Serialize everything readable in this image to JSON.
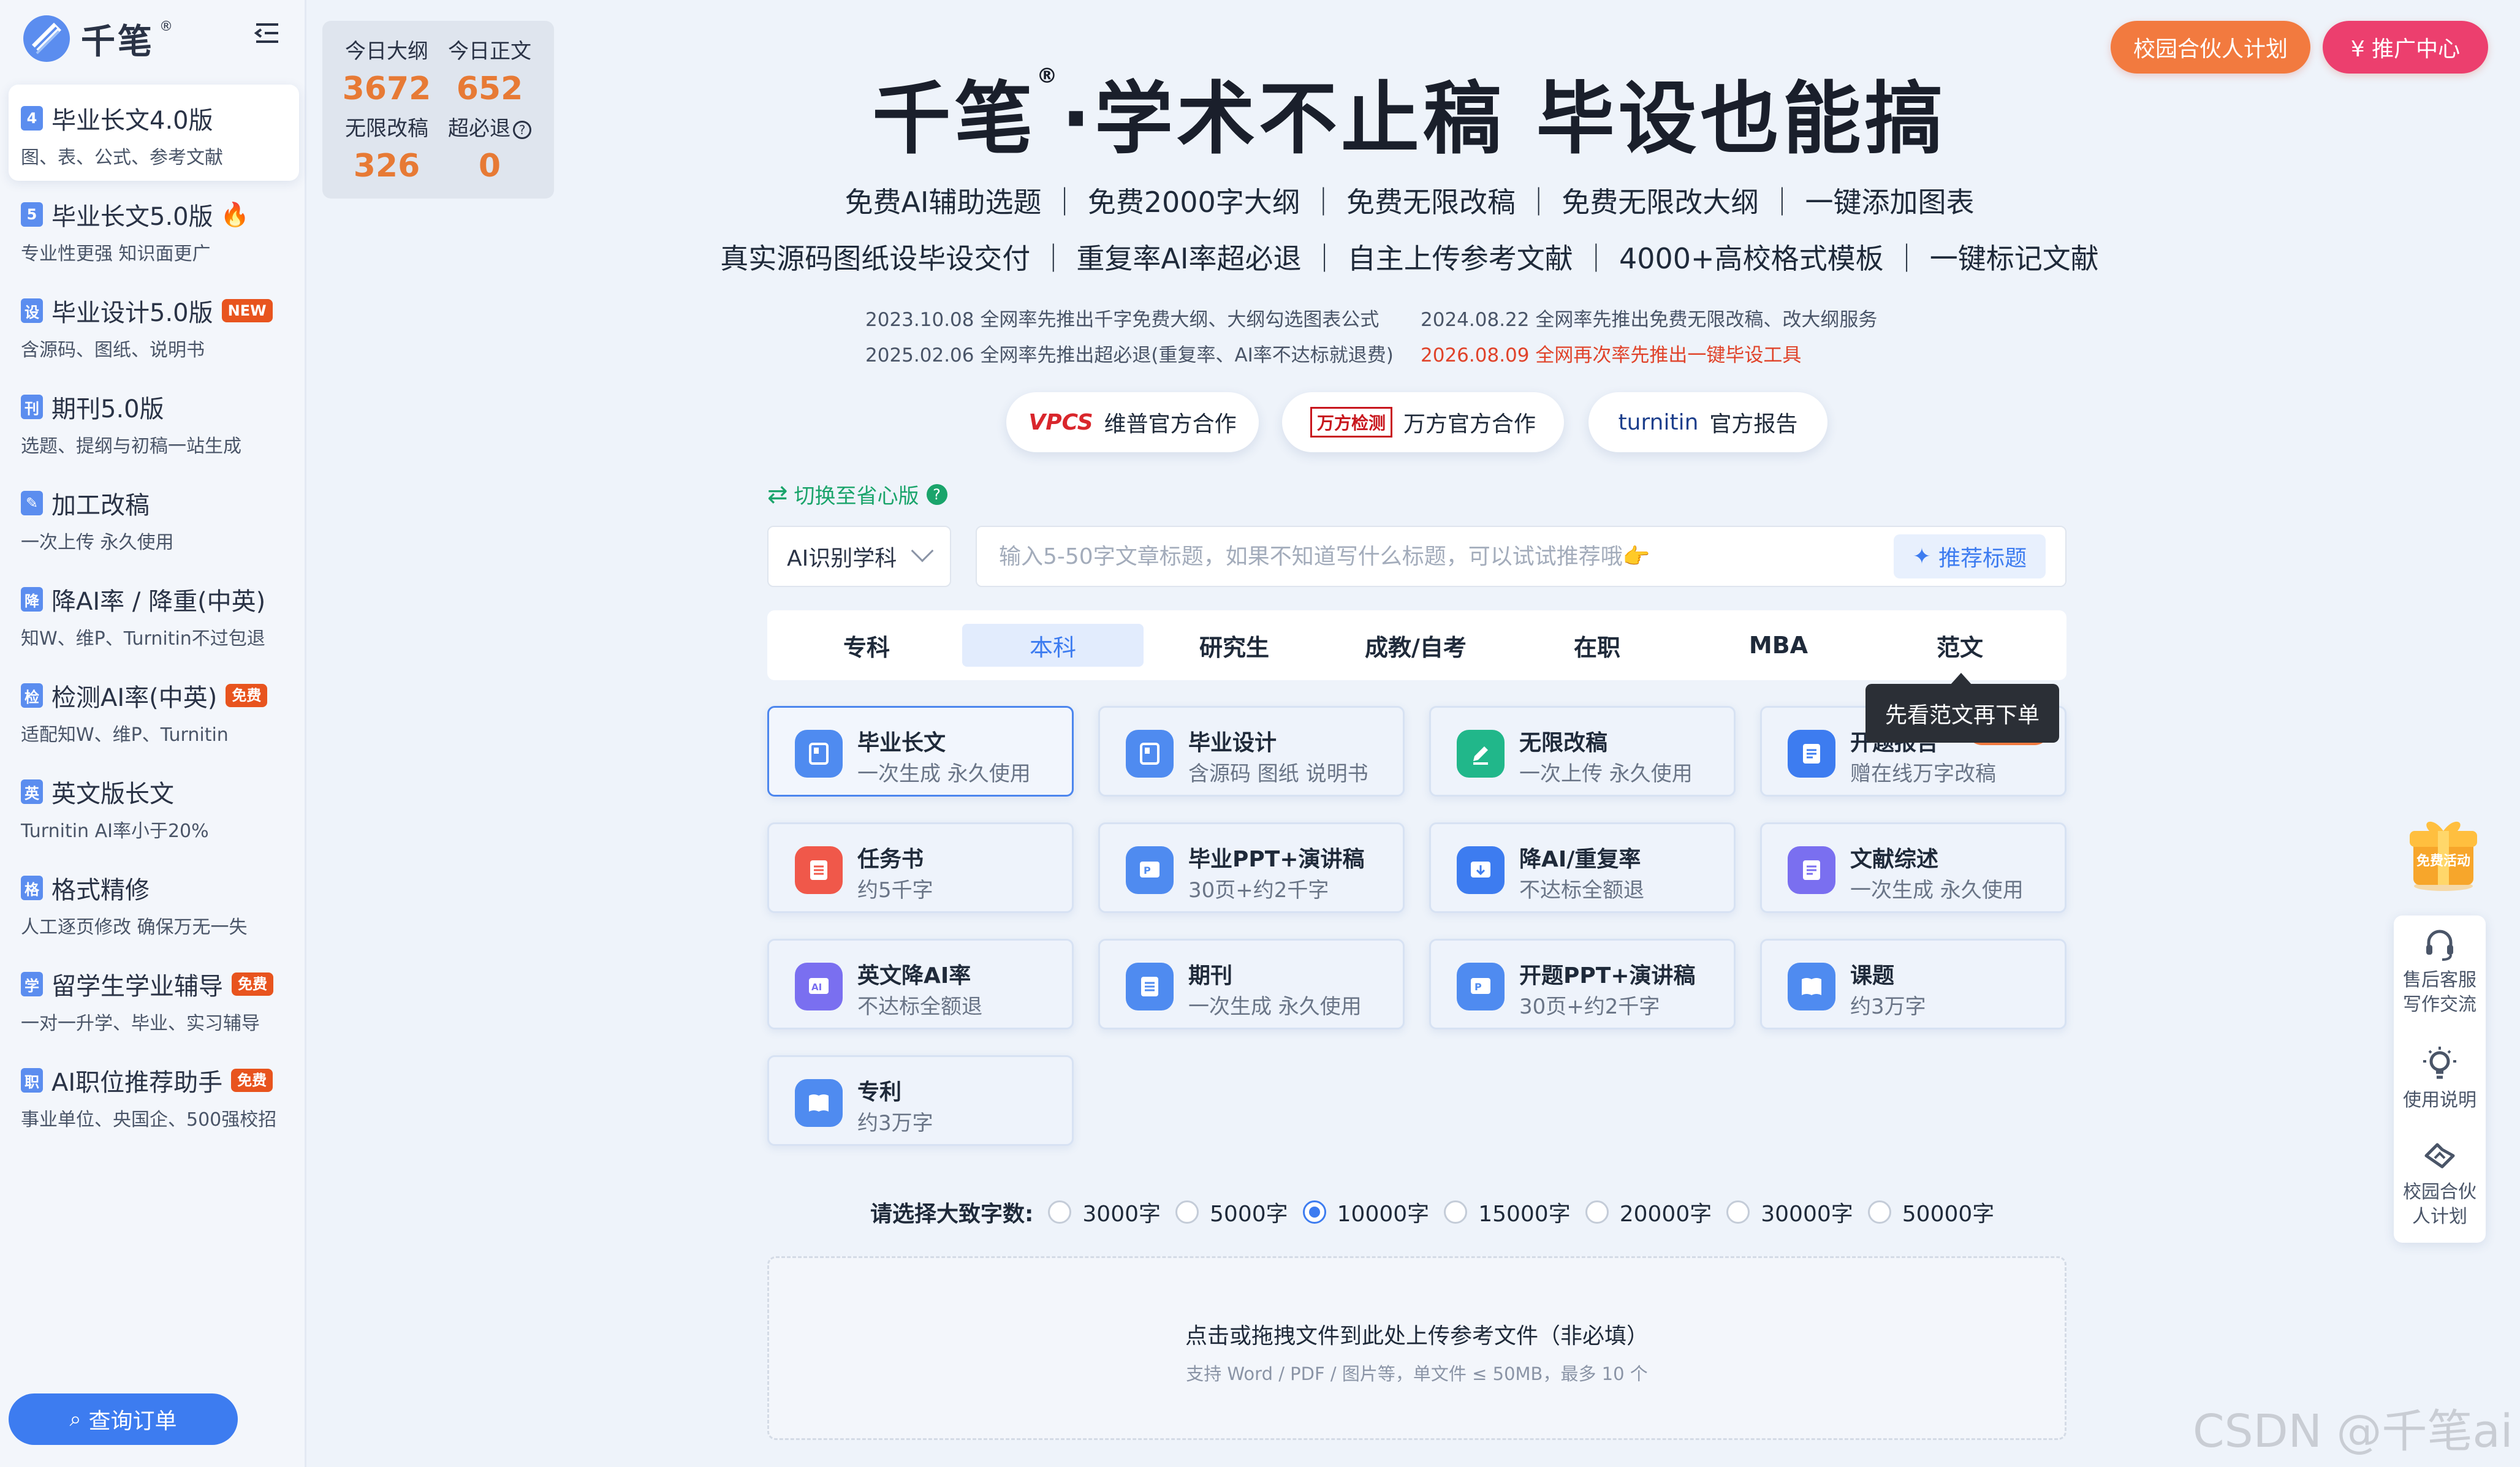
{
  "sidebar": {
    "logo_text": "千笔",
    "logo_reg": "®",
    "items": [
      {
        "icon": "4",
        "title": "毕业长文4.0版",
        "sub": "图、表、公式、参考文献",
        "badge": ""
      },
      {
        "icon": "5",
        "title": "毕业长文5.0版",
        "sub": "专业性更强 知识面更广",
        "badge": ""
      },
      {
        "icon": "设",
        "title": "毕业设计5.0版",
        "sub": "含源码、图纸、说明书",
        "badge": "NEW"
      },
      {
        "icon": "刊",
        "title": "期刊5.0版",
        "sub": "选题、提纲与初稿一站生成",
        "badge": ""
      },
      {
        "icon": "✎",
        "title": "加工改稿",
        "sub": "一次上传 永久使用",
        "badge": ""
      },
      {
        "icon": "降",
        "title": "降AI率 / 降重(中英)",
        "sub": "知W、维P、Turnitin不过包退",
        "badge": ""
      },
      {
        "icon": "检",
        "title": "检测AI率(中英)",
        "sub": "适配知W、维P、Turnitin",
        "badge": "免费"
      },
      {
        "icon": "英",
        "title": "英文版长文",
        "sub": "Turnitin AI率小于20%",
        "badge": ""
      },
      {
        "icon": "格",
        "title": "格式精修",
        "sub": "人工逐页修改 确保万无一失",
        "badge": ""
      },
      {
        "icon": "学",
        "title": "留学生学业辅导",
        "sub": "一对一升学、毕业、实习辅导",
        "badge": "免费"
      },
      {
        "icon": "职",
        "title": "AI职位推荐助手",
        "sub": "事业单位、央国企、500强校招",
        "badge": "免费"
      }
    ],
    "order_button": "查询订单"
  },
  "stats": {
    "outline_label": "今日大纲",
    "outline_value": "3672",
    "body_label": "今日正文",
    "body_value": "652",
    "revise_label": "无限改稿",
    "revise_value": "326",
    "refund_label": "超必退",
    "refund_value": "0"
  },
  "top_buttons": {
    "campus": "校园合伙人计划",
    "promo": "¥  推广中心"
  },
  "hero": {
    "title_brand": "千笔",
    "title_rest": "·学术不止稿  毕设也能搞",
    "features_line1": "免费AI辅助选题 ｜ 免费2000字大纲 ｜ 免费无限改稿 ｜ 免费无限改大纲 ｜ 一键添加图表",
    "features_line2": "真实源码图纸设毕设交付 ｜ 重复率AI率超必退 ｜ 自主上传参考文献 ｜ 4000+高校格式模板 ｜ 一键标记文献",
    "news": [
      "2023.10.08 全网率先推出千字免费大纲、大纲勾选图表公式",
      "2024.08.22 全网率先推出免费无限改稿、改大纲服务",
      "2025.02.06 全网率先推出超必退(重复率、AI率不达标就退费)",
      "2026.08.09 全网再次率先推出一键毕设工具"
    ],
    "partners": [
      {
        "logo": "VPCS",
        "label": "维普官方合作"
      },
      {
        "logo": "万方检测",
        "label": "万方官方合作"
      },
      {
        "logo": "turnitin",
        "label": "官方报告"
      }
    ]
  },
  "form": {
    "switch_label": "切换至省心版",
    "subject_select": "AI识别学科",
    "title_placeholder": "输入5-50字文章标题，如果不知道写什么标题，可以试试推荐哦👉",
    "recommend_button": "推荐标题",
    "tabs": [
      "专科",
      "本科",
      "研究生",
      "成教/自考",
      "在职",
      "MBA",
      "范文"
    ],
    "active_tab": "本科",
    "tooltip": "先看范文再下单"
  },
  "cards": [
    {
      "title": "毕业长文",
      "sub": "一次生成 永久使用",
      "icon": "doc-icon",
      "color": "#4f8bf0"
    },
    {
      "title": "毕业设计",
      "sub": "含源码 图纸 说明书",
      "icon": "design-icon",
      "color": "#4f8bf0"
    },
    {
      "title": "无限改稿",
      "sub": "一次上传 永久使用",
      "icon": "edit-icon",
      "color": "#21b78a"
    },
    {
      "title": "开题报告",
      "sub": "赠在线万字改稿",
      "icon": "report-icon",
      "color": "#3d7cf0"
    },
    {
      "title": "任务书",
      "sub": "约5千字",
      "icon": "task-icon",
      "color": "#f0584a"
    },
    {
      "title": "毕业PPT+演讲稿",
      "sub": "30页+约2千字",
      "icon": "ppt-icon",
      "color": "#4f8bf0"
    },
    {
      "title": "降AI/重复率",
      "sub": "不达标全额退",
      "icon": "reduce-icon",
      "color": "#3d7cf0"
    },
    {
      "title": "文献综述",
      "sub": "一次生成 永久使用",
      "icon": "review-icon",
      "color": "#7a6ff0"
    },
    {
      "title": "英文降AI率",
      "sub": "不达标全额退",
      "icon": "ai-icon",
      "color": "#7a6ff0"
    },
    {
      "title": "期刊",
      "sub": "一次生成 永久使用",
      "icon": "journal-icon",
      "color": "#4f8bf0"
    },
    {
      "title": "开题PPT+演讲稿",
      "sub": "30页+约2千字",
      "icon": "ppt-icon",
      "color": "#4f8bf0"
    },
    {
      "title": "课题",
      "sub": "约3万字",
      "icon": "book-icon",
      "color": "#4f8bf0"
    },
    {
      "title": "专利",
      "sub": "约3万字",
      "icon": "book-icon",
      "color": "#4f8bf0"
    }
  ],
  "wordcount": {
    "label": "请选择大致字数:",
    "options": [
      "3000字",
      "5000字",
      "10000字",
      "15000字",
      "20000字",
      "30000字",
      "50000字"
    ],
    "selected": "10000字"
  },
  "upload": {
    "title": "点击或拖拽文件到此处上传参考文件（非必填）",
    "hint": "支持 Word / PDF / 图片等，单文件 ≤ 50MB，最多 10 个"
  },
  "float": {
    "gift_text": "免费活动",
    "items": [
      "售后客服写作交流",
      "使用说明",
      "校园合伙人计划"
    ]
  },
  "watermark": "CSDN @千笔ai"
}
